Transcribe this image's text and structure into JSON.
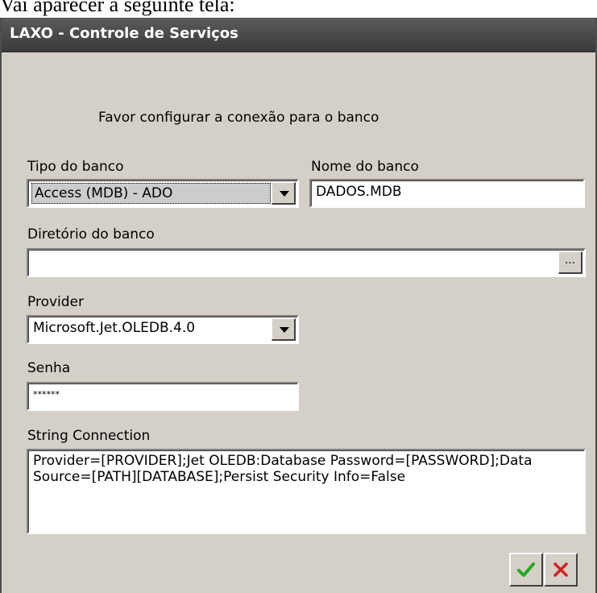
{
  "caption": "Vai aparecer a seguinte tela:",
  "window": {
    "title": "LAXO - Controle de Serviços"
  },
  "form": {
    "intro": "Favor configurar a conexão para o banco",
    "tipo_label": "Tipo do banco",
    "tipo_value": "Access (MDB) - ADO",
    "nome_label": "Nome do banco",
    "nome_value": "DADOS.MDB",
    "dir_label": "Diretório do banco",
    "dir_value": "",
    "browse_label": "...",
    "provider_label": "Provider",
    "provider_value": "Microsoft.Jet.OLEDB.4.0",
    "senha_label": "Senha",
    "senha_value": "******",
    "string_label": "String Connection",
    "string_value": "Provider=[PROVIDER];Jet OLEDB:Database Password=[PASSWORD];Data Source=[PATH][DATABASE];Persist Security Info=False"
  },
  "buttons": {
    "ok_icon": "check-icon",
    "cancel_icon": "x-icon",
    "ok_color": "#22aa22",
    "cancel_color": "#d42020"
  }
}
